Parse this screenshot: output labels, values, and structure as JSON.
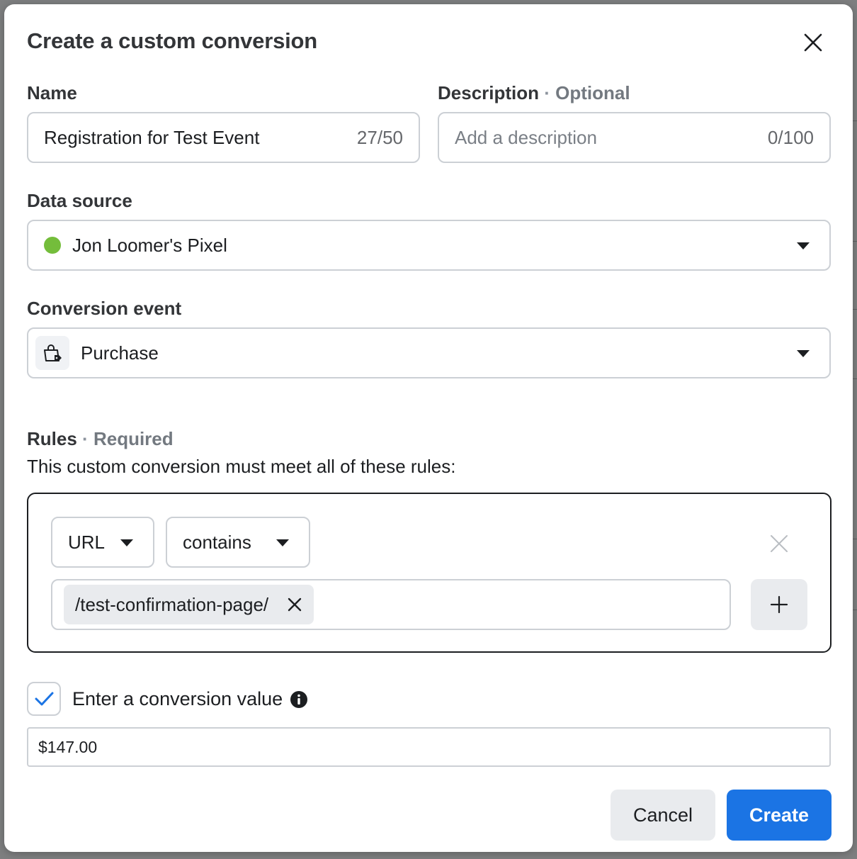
{
  "dialog": {
    "title": "Create a custom conversion"
  },
  "name": {
    "label": "Name",
    "value": "Registration for Test Event",
    "counter": "27/50"
  },
  "description": {
    "label": "Description",
    "separator": "·",
    "optional": "Optional",
    "placeholder": "Add a description",
    "counter": "0/100"
  },
  "data_source": {
    "label": "Data source",
    "value": "Jon Loomer's Pixel",
    "status_color": "#74bd3b"
  },
  "conversion_event": {
    "label": "Conversion event",
    "value": "Purchase",
    "icon": "shopping-bag-icon"
  },
  "rules": {
    "label": "Rules",
    "separator": "·",
    "required": "Required",
    "description": "This custom conversion must meet all of these rules:",
    "field_dropdown": "URL",
    "operator_dropdown": "contains",
    "chip_value": "/test-confirmation-page/"
  },
  "conversion_value": {
    "checkbox_label": "Enter a conversion value",
    "checked": true,
    "value": "$147.00"
  },
  "footer": {
    "cancel_label": "Cancel",
    "create_label": "Create"
  },
  "colors": {
    "primary": "#1b74e4",
    "check": "#1b74e4"
  }
}
